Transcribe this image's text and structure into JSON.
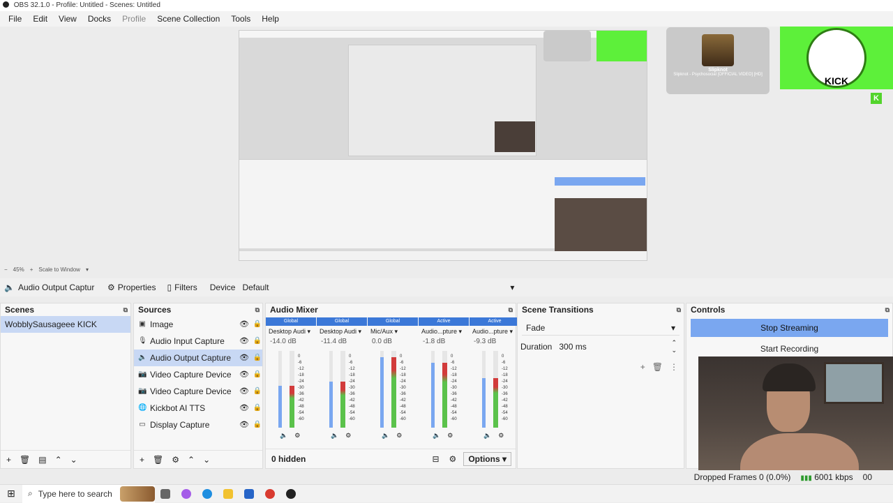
{
  "window": {
    "title": "OBS 32.1.0 - Profile: Untitled - Scenes: Untitled"
  },
  "menu": [
    "File",
    "Edit",
    "View",
    "Docks",
    "Profile",
    "Scene Collection",
    "Tools",
    "Help"
  ],
  "overlay": {
    "card_title": "Slipknot",
    "card_sub": "Slipknot - Psychosocial [OFFICIAL VIDEO] [HD]",
    "kick_label": "KICK",
    "kick_badge": "K"
  },
  "zoom": {
    "level": "45%",
    "mode": "Scale to Window"
  },
  "context_bar": {
    "source": "Audio Output Captur",
    "properties": "Properties",
    "filters": "Filters",
    "device_label": "Device",
    "device_value": "Default"
  },
  "scenes": {
    "title": "Scenes",
    "items": [
      "WobblySausageee KICK"
    ]
  },
  "sources": {
    "title": "Sources",
    "items": [
      {
        "name": "Image",
        "icon": "image-icon"
      },
      {
        "name": "Audio Input Capture",
        "icon": "microphone-icon"
      },
      {
        "name": "Audio Output Capture",
        "icon": "speaker-icon"
      },
      {
        "name": "Video Capture Device",
        "icon": "camera-icon"
      },
      {
        "name": "Video Capture Device",
        "icon": "camera-icon"
      },
      {
        "name": "Kickbot AI TTS",
        "icon": "globe-icon"
      },
      {
        "name": "Display Capture",
        "icon": "monitor-icon"
      }
    ]
  },
  "mixer": {
    "title": "Audio Mixer",
    "hidden": "0 hidden",
    "options": "Options",
    "channels": [
      {
        "badge": "Global",
        "name": "Desktop Audi",
        "db": "-14.0 dB",
        "level": 0.55
      },
      {
        "badge": "Global",
        "name": "Desktop Audi",
        "db": "-11.4 dB",
        "level": 0.6
      },
      {
        "badge": "Global",
        "name": "Mic/Aux",
        "db": "0.0 dB",
        "level": 0.92
      },
      {
        "badge": "Active",
        "name": "Audio...pture",
        "db": "-1.8 dB",
        "level": 0.85
      },
      {
        "badge": "Active",
        "name": "Audio...pture",
        "db": "-9.3 dB",
        "level": 0.65
      }
    ],
    "scale": [
      "0",
      "-6",
      "-12",
      "-18",
      "-24",
      "-30",
      "-36",
      "-42",
      "-48",
      "-54",
      "-60"
    ]
  },
  "transitions": {
    "title": "Scene Transitions",
    "type": "Fade",
    "duration_label": "Duration",
    "duration_value": "300 ms"
  },
  "controls": {
    "title": "Controls",
    "stop_streaming": "Stop Streaming",
    "start_recording": "Start Recording"
  },
  "status": {
    "dropped": "Dropped Frames 0 (0.0%)",
    "kbps": "6001 kbps",
    "time": "00"
  },
  "taskbar": {
    "search_placeholder": "Type here to search"
  },
  "colors": {
    "accent": "#7aa7f0",
    "selection": "#c8d8f4",
    "kick_green": "#5df03a"
  }
}
